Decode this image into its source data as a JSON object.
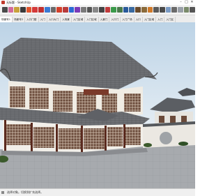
{
  "window": {
    "title": "无标题 - SketchUp",
    "min": "–",
    "max": "□",
    "close": "✕"
  },
  "toolbar": {
    "icons": [
      {
        "name": "select-icon",
        "color": "#4a4a4a"
      },
      {
        "name": "eraser-icon",
        "color": "#d46a9a"
      },
      {
        "name": "paint-icon",
        "color": "#c8a13a"
      },
      {
        "name": "pencil-icon",
        "color": "#3a3a3a"
      },
      {
        "name": "arc-icon",
        "color": "#e0542c"
      },
      {
        "name": "rectangle-icon",
        "color": "#d43a3a"
      },
      {
        "name": "circle-icon",
        "color": "#c03030"
      },
      {
        "name": "polygon-icon",
        "color": "#3a7ad4"
      },
      {
        "name": "push-pull-icon",
        "color": "#6a6a6a"
      },
      {
        "name": "move-icon",
        "color": "#d4402a"
      },
      {
        "name": "rotate-icon",
        "color": "#b83a3a"
      },
      {
        "name": "scale-icon",
        "color": "#2a6ad4"
      },
      {
        "name": "offset-icon",
        "color": "#7a3ab8"
      },
      {
        "name": "tape-icon",
        "color": "#7a7a7a"
      },
      {
        "name": "dimension-icon",
        "color": "#555555"
      },
      {
        "name": "protractor-icon",
        "color": "#888888"
      },
      {
        "name": "text-icon",
        "color": "#444444"
      },
      {
        "name": "axes-icon",
        "color": "#c03a3a"
      },
      {
        "name": "orbit-icon",
        "color": "#3a9a4a"
      },
      {
        "name": "pan-icon",
        "color": "#4a7a4a"
      },
      {
        "name": "zoom-icon",
        "color": "#2a5a9a"
      },
      {
        "name": "zoom-extents-icon",
        "color": "#3a6aa0"
      },
      {
        "name": "walk-icon",
        "color": "#6a4a2a"
      },
      {
        "name": "look-around-icon",
        "color": "#8a6a3a"
      },
      {
        "name": "section-icon",
        "color": "#d07a2a"
      },
      {
        "name": "components-icon",
        "color": "#5a5a5a"
      },
      {
        "name": "styles-icon",
        "color": "#4a4a4a"
      },
      {
        "name": "xray-icon",
        "color": "#7a9ac4"
      },
      {
        "name": "wireframe-icon",
        "color": "#6a6a6a"
      },
      {
        "name": "shaded-icon",
        "color": "#9aa0a8"
      },
      {
        "name": "textured-icon",
        "color": "#7a8a6a"
      },
      {
        "name": "monochrome-icon",
        "color": "#555555"
      }
    ]
  },
  "tabs": [
    "场景号1",
    "场景号2",
    "入口门楼",
    "入门",
    "入口大门",
    "入场景",
    "入门区域",
    "入门区域",
    "入景门",
    "入口门",
    "入门广场",
    "入口",
    "入门区域",
    "入门",
    "入门区"
  ],
  "status": {
    "text": "选择对象。切换到扩充选择。"
  }
}
